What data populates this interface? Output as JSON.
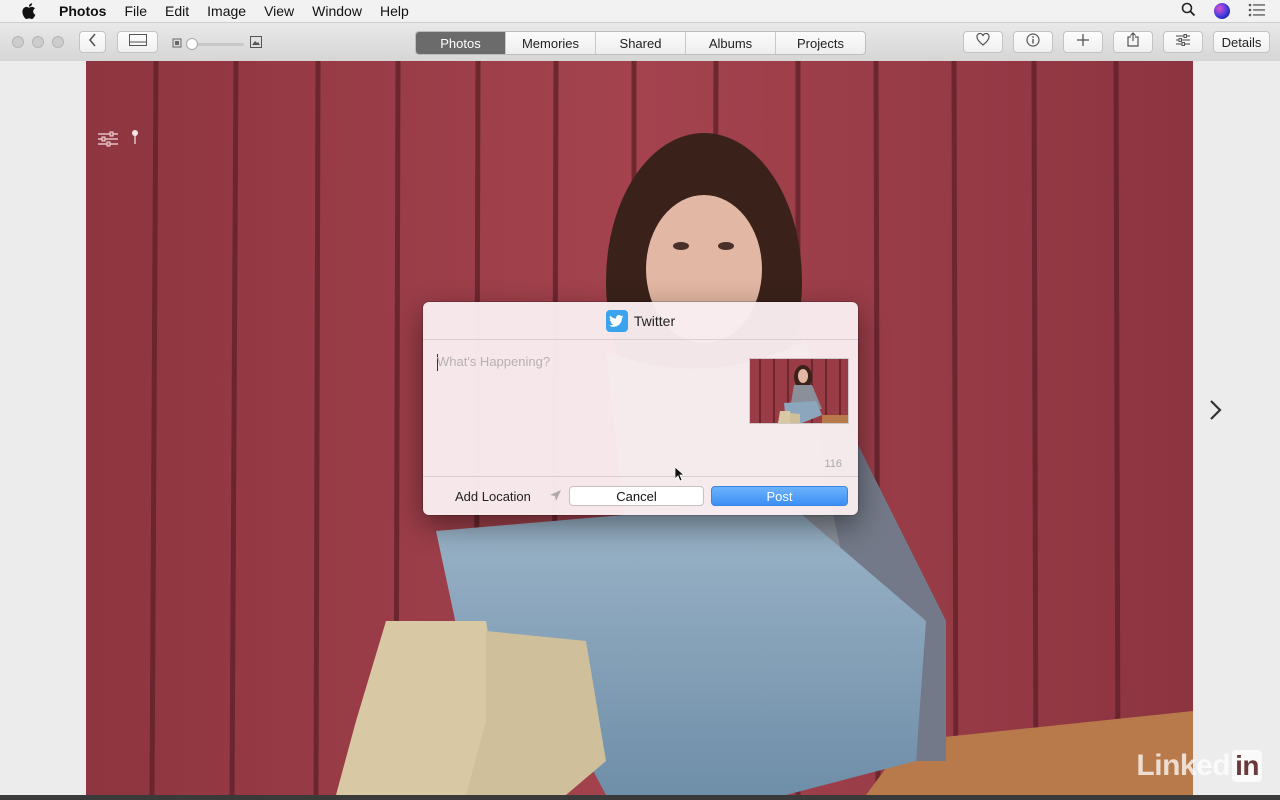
{
  "menubar": {
    "app": "Photos",
    "items": [
      "File",
      "Edit",
      "Image",
      "View",
      "Window",
      "Help"
    ],
    "icons": [
      "apple-icon",
      "search-icon",
      "siri-icon",
      "notification-center-icon"
    ]
  },
  "toolbar": {
    "tabs": [
      {
        "label": "Photos",
        "selected": true
      },
      {
        "label": "Memories",
        "selected": false
      },
      {
        "label": "Shared",
        "selected": false
      },
      {
        "label": "Albums",
        "selected": false
      },
      {
        "label": "Projects",
        "selected": false
      }
    ],
    "details_label": "Details",
    "icons": [
      "back-icon",
      "sidebar-icon",
      "zoom-small-icon",
      "zoom-large-icon",
      "heart-icon",
      "info-icon",
      "plus-icon",
      "share-icon",
      "adjust-icon"
    ]
  },
  "dialog": {
    "title": "Twitter",
    "placeholder": "What's Happening?",
    "char_count": "116",
    "add_location": "Add Location",
    "cancel_label": "Cancel",
    "post_label": "Post"
  },
  "watermark": {
    "brand": "Linked",
    "suffix": "in"
  },
  "colors": {
    "accent": "#3d8ff4",
    "twitter_blue": "#3aa3ee",
    "selected_tab": "#6b6b6b",
    "barn_red": "#9a3c45"
  }
}
